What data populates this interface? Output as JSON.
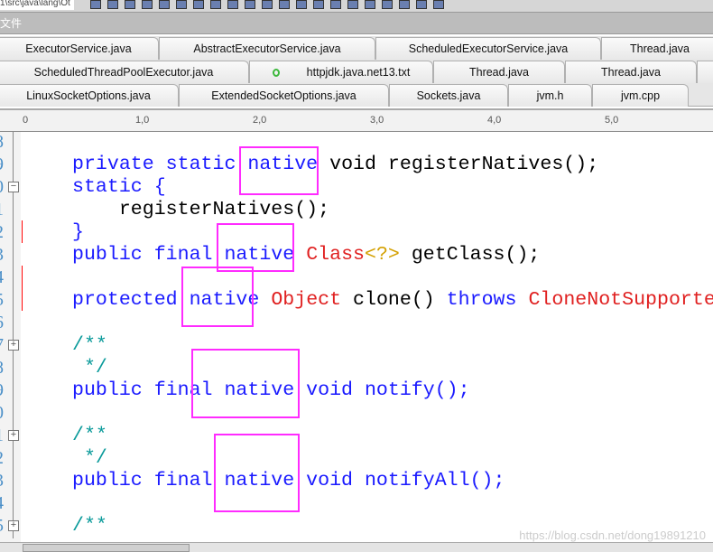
{
  "toolbar": {
    "path": "1\\src\\java\\lang\\Ot"
  },
  "menubar": {
    "label": "文件"
  },
  "tabs": [
    [
      {
        "label": "ExecutorService.java"
      },
      {
        "label": "AbstractExecutorService.java"
      },
      {
        "label": "ScheduledExecutorService.java"
      },
      {
        "label": "Thread.java"
      }
    ],
    [
      {
        "label": "ScheduledThreadPoolExecutor.java"
      },
      {
        "label": "httpjdk.java.net13.txt",
        "status": "saved-circle"
      },
      {
        "label": "Thread.java"
      },
      {
        "label": "Thread.java"
      },
      {
        "label": ""
      }
    ],
    [
      {
        "label": "LinuxSocketOptions.java"
      },
      {
        "label": "ExtendedSocketOptions.java"
      },
      {
        "label": "Sockets.java"
      },
      {
        "label": "jvm.h"
      },
      {
        "label": "jvm.cpp"
      }
    ]
  ],
  "ruler": [
    "0",
    "1,0",
    "2,0",
    "3,0",
    "4,0",
    "5,0"
  ],
  "line_numbers": [
    "8",
    "9",
    "0",
    "1",
    "2",
    "3",
    "4",
    "5",
    "6",
    "7",
    "8",
    "9",
    "0",
    "1",
    "2",
    "3",
    "4",
    "5"
  ],
  "code": {
    "l1": {
      "a": "private static ",
      "b": "native",
      "c": " void registerNatives();"
    },
    "l2": "static {",
    "l3": "    registerNatives();",
    "l4": "}",
    "l5": {
      "a": "public final ",
      "b": "native",
      "c": " Class",
      "d": "<?>",
      "e": " getClass();"
    },
    "l6": {
      "a": "protected ",
      "b": "native",
      "c": " Object",
      "d": " clone() ",
      "e": "throws",
      "f": " CloneNotSupporte"
    },
    "l7": "/**",
    "l8": " */",
    "l9": {
      "a": "public final native void notify();"
    },
    "l10": "/**",
    "l11": " */",
    "l12": {
      "a": "public final native void notifyAll();"
    },
    "l13": "/**"
  },
  "highlight_color": "#ff2bff",
  "watermark": "https://blog.csdn.net/dong19891210"
}
